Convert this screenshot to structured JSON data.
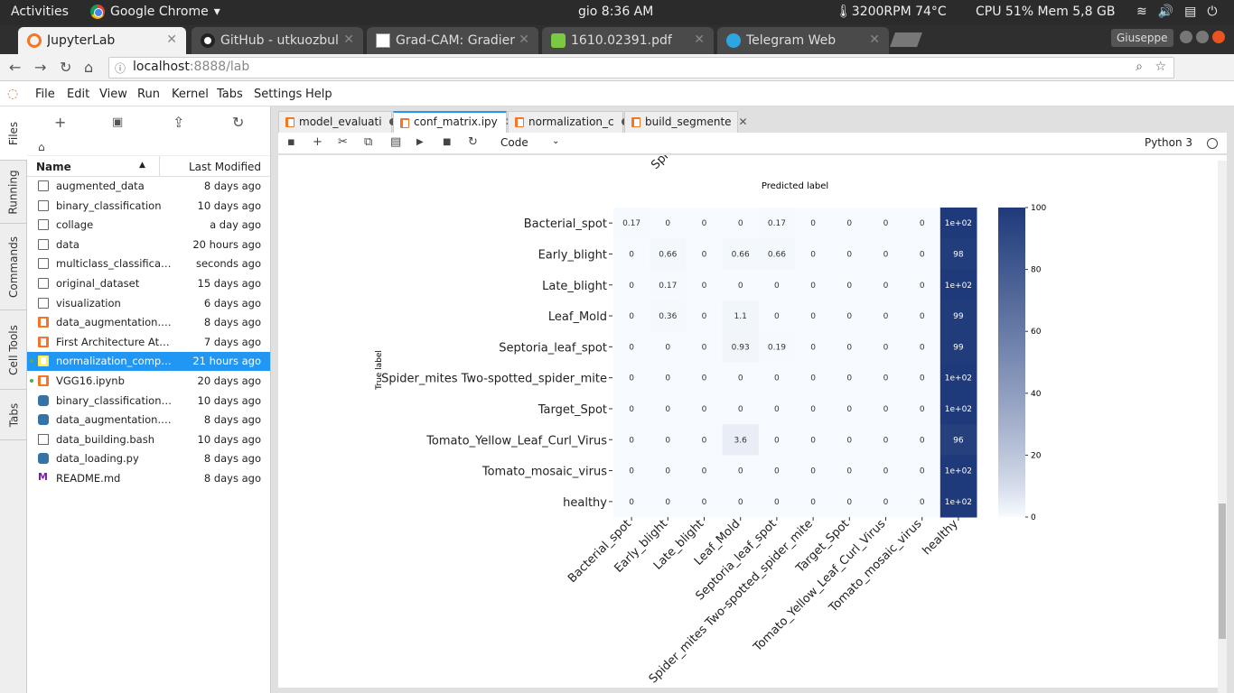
{
  "system": {
    "activities": "Activities",
    "app": "Google Chrome",
    "clock": "gio  8:36 AM",
    "fan": "3200RPM 74°C",
    "cpu": "CPU 51% Mem 5,8 GB"
  },
  "browser": {
    "tabs": [
      {
        "label": "JupyterLab",
        "fav": "#f37726"
      },
      {
        "label": "GitHub - utkuozbul",
        "fav": "#222"
      },
      {
        "label": "Grad-CAM: Gradient",
        "fav": "#b31b1b"
      },
      {
        "label": "1610.02391.pdf",
        "fav": "#7ac943"
      },
      {
        "label": "Telegram Web",
        "fav": "#2ca5e0"
      }
    ],
    "user": "Giuseppe",
    "url_host": "localhost",
    "url_rest": ":8888/lab"
  },
  "menu": [
    "File",
    "Edit",
    "View",
    "Run",
    "Kernel",
    "Tabs",
    "Settings",
    "Help"
  ],
  "side_tabs": [
    "Files",
    "Running",
    "Commands",
    "Cell Tools",
    "Tabs"
  ],
  "files": {
    "header_name": "Name",
    "header_modified": "Last Modified",
    "items": [
      {
        "name": "augmented_data",
        "modified": "8 days ago",
        "type": "folder"
      },
      {
        "name": "binary_classification",
        "modified": "10 days ago",
        "type": "folder"
      },
      {
        "name": "collage",
        "modified": "a day ago",
        "type": "folder"
      },
      {
        "name": "data",
        "modified": "20 hours ago",
        "type": "folder"
      },
      {
        "name": "multiclass_classification",
        "modified": "seconds ago",
        "type": "folder"
      },
      {
        "name": "original_dataset",
        "modified": "15 days ago",
        "type": "folder"
      },
      {
        "name": "visualization",
        "modified": "6 days ago",
        "type": "folder"
      },
      {
        "name": "data_augmentation.ipynb",
        "modified": "8 days ago",
        "type": "notebook"
      },
      {
        "name": "First Architecture Attempt.ipynb",
        "modified": "7 days ago",
        "type": "notebook"
      },
      {
        "name": "normalization_computation.ipynb",
        "modified": "21 hours ago",
        "type": "notebook",
        "selected": true,
        "running": true
      },
      {
        "name": "VGG16.ipynb",
        "modified": "20 days ago",
        "type": "notebook",
        "running": true
      },
      {
        "name": "binary_classification_data.py",
        "modified": "10 days ago",
        "type": "python"
      },
      {
        "name": "data_augmentation.py",
        "modified": "8 days ago",
        "type": "python"
      },
      {
        "name": "data_building.bash",
        "modified": "10 days ago",
        "type": "file"
      },
      {
        "name": "data_loading.py",
        "modified": "8 days ago",
        "type": "python"
      },
      {
        "name": "README.md",
        "modified": "8 days ago",
        "type": "markdown"
      }
    ]
  },
  "notebook_tabs": [
    {
      "label": "model_evaluati",
      "state": "dirty"
    },
    {
      "label": "conf_matrix.ipy",
      "state": "active"
    },
    {
      "label": "normalization_c",
      "state": "dirty"
    },
    {
      "label": "build_segmente",
      "state": "close"
    }
  ],
  "toolbar": {
    "cell_type": "Code",
    "kernel": "Python 3"
  },
  "chart_data": {
    "type": "heatmap",
    "xlabel": "Predicted label",
    "ylabel": "True label",
    "top_cut_label": "Spid",
    "categories": [
      "Bacterial_spot",
      "Early_blight",
      "Late_blight",
      "Leaf_Mold",
      "Septoria_leaf_spot",
      "Spider_mites Two-spotted_spider_mite",
      "Target_Spot",
      "Tomato_Yellow_Leaf_Curl_Virus",
      "Tomato_mosaic_virus",
      "healthy"
    ],
    "values": [
      [
        "0.17",
        "0",
        "0",
        "0",
        "0.17",
        "0",
        "0",
        "0",
        "0",
        "1e+02"
      ],
      [
        "0",
        "0.66",
        "0",
        "0.66",
        "0.66",
        "0",
        "0",
        "0",
        "0",
        "98"
      ],
      [
        "0",
        "0.17",
        "0",
        "0",
        "0",
        "0",
        "0",
        "0",
        "0",
        "1e+02"
      ],
      [
        "0",
        "0.36",
        "0",
        "1.1",
        "0",
        "0",
        "0",
        "0",
        "0",
        "99"
      ],
      [
        "0",
        "0",
        "0",
        "0.93",
        "0.19",
        "0",
        "0",
        "0",
        "0",
        "99"
      ],
      [
        "0",
        "0",
        "0",
        "0",
        "0",
        "0",
        "0",
        "0",
        "0",
        "1e+02"
      ],
      [
        "0",
        "0",
        "0",
        "0",
        "0",
        "0",
        "0",
        "0",
        "0",
        "1e+02"
      ],
      [
        "0",
        "0",
        "0",
        "3.6",
        "0",
        "0",
        "0",
        "0",
        "0",
        "96"
      ],
      [
        "0",
        "0",
        "0",
        "0",
        "0",
        "0",
        "0",
        "0",
        "0",
        "1e+02"
      ],
      [
        "0",
        "0",
        "0",
        "0",
        "0",
        "0",
        "0",
        "0",
        "0",
        "1e+02"
      ]
    ],
    "numeric": [
      [
        0.17,
        0,
        0,
        0,
        0.17,
        0,
        0,
        0,
        0,
        100
      ],
      [
        0,
        0.66,
        0,
        0.66,
        0.66,
        0,
        0,
        0,
        0,
        98
      ],
      [
        0,
        0.17,
        0,
        0,
        0,
        0,
        0,
        0,
        0,
        100
      ],
      [
        0,
        0.36,
        0,
        1.1,
        0,
        0,
        0,
        0,
        0,
        99
      ],
      [
        0,
        0,
        0,
        0.93,
        0.19,
        0,
        0,
        0,
        0,
        99
      ],
      [
        0,
        0,
        0,
        0,
        0,
        0,
        0,
        0,
        0,
        100
      ],
      [
        0,
        0,
        0,
        0,
        0,
        0,
        0,
        0,
        0,
        100
      ],
      [
        0,
        0,
        0,
        3.6,
        0,
        0,
        0,
        0,
        0,
        96
      ],
      [
        0,
        0,
        0,
        0,
        0,
        0,
        0,
        0,
        0,
        100
      ],
      [
        0,
        0,
        0,
        0,
        0,
        0,
        0,
        0,
        0,
        100
      ]
    ],
    "colorbar": {
      "min": 0,
      "max": 100,
      "ticks": [
        "0",
        "20",
        "40",
        "60",
        "80",
        "100"
      ]
    },
    "colors": {
      "low": "#f7fbff",
      "high": "#1f3a7a"
    }
  }
}
